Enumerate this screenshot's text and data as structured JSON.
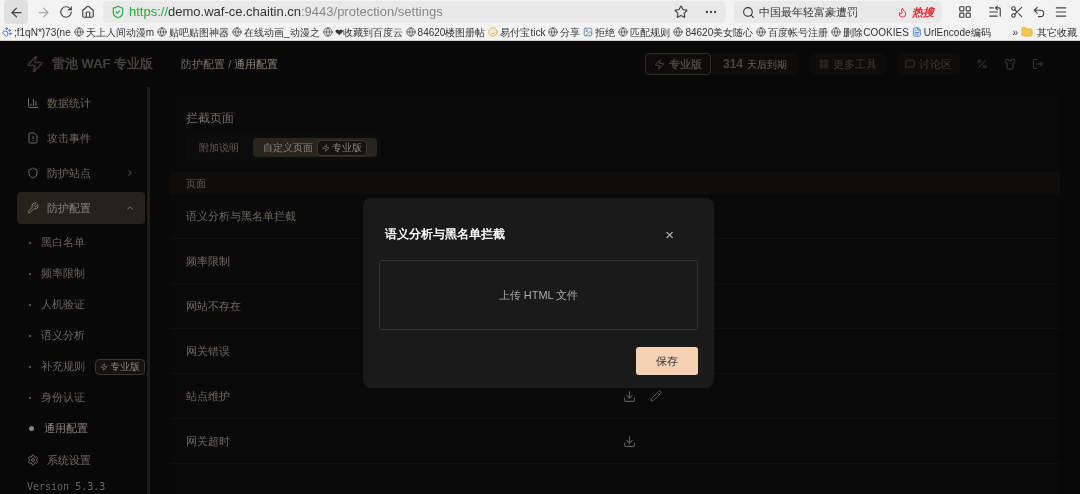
{
  "browser": {
    "url_host": "https://demo.waf-ce.chaitin.cn",
    "url_path": ":9443/protection/settings",
    "search_text": "中国最年轻富豪遭罚",
    "hot_label": "热搜",
    "bookmarks": [
      {
        "label": ";f1qN*)73(ne",
        "kind": "paw"
      },
      {
        "label": "天上人间动漫m",
        "kind": "globe"
      },
      {
        "label": "贴吧贴图神器",
        "kind": "globe"
      },
      {
        "label": "在线动画_动漫之",
        "kind": "globe"
      },
      {
        "label": "❤收藏到百度云",
        "kind": "globe"
      },
      {
        "label": "84620楼图册帖",
        "kind": "globe"
      },
      {
        "label": "易付宝tick",
        "kind": "coin"
      },
      {
        "label": "分享",
        "kind": "globe"
      },
      {
        "label": "拒绝",
        "kind": "image"
      },
      {
        "label": "匹配规则",
        "kind": "globe"
      },
      {
        "label": "84620美女随心",
        "kind": "globe"
      },
      {
        "label": "百度帐号注册",
        "kind": "globe"
      },
      {
        "label": "删除COOKIES",
        "kind": "globe"
      },
      {
        "label": "UrlEncode编码",
        "kind": "doc"
      }
    ],
    "overflow": "»",
    "other_folder": "其它收藏"
  },
  "app": {
    "brand": "雷池 WAF 专业版",
    "breadcrumb": [
      "防护配置",
      "通用配置"
    ],
    "breadcrumb_separator": "/",
    "header": {
      "pro_label": "专业版",
      "days": "314",
      "days_suffix": "天后到期",
      "tools": [
        {
          "label": "更多工具",
          "kind": "grid"
        },
        {
          "label": "讨论区",
          "kind": "chat"
        }
      ]
    },
    "sidebar": [
      {
        "label": "数据统计",
        "kind": "chart",
        "selected": false
      },
      {
        "label": "攻击事件",
        "kind": "doc",
        "selected": false
      },
      {
        "label": "防护站点",
        "kind": "shield",
        "expanded": false,
        "selected": false
      },
      {
        "label": "防护配置",
        "kind": "tools",
        "expanded": true,
        "selected": true,
        "children": [
          {
            "label": "黑白名单",
            "selected": false
          },
          {
            "label": "频率限制",
            "selected": false
          },
          {
            "label": "人机验证",
            "selected": false
          },
          {
            "label": "语义分析",
            "selected": false
          },
          {
            "label": "补充规则",
            "selected": false,
            "badge": "专业版"
          },
          {
            "label": "身份认证",
            "selected": false
          },
          {
            "label": "通用配置",
            "selected": true
          }
        ]
      },
      {
        "label": "系统设置",
        "kind": "gear",
        "selected": false
      }
    ],
    "version": "Version 5.3.3",
    "content": {
      "title": "拦截页面",
      "tabs": [
        {
          "label": "附加说明",
          "selected": false
        },
        {
          "label": "自定义页面",
          "selected": true,
          "badge": "专业版"
        }
      ],
      "section": "页面",
      "rows": [
        {
          "label": "语义分析与黑名单拦截"
        },
        {
          "label": "频率限制"
        },
        {
          "label": "网站不存在"
        },
        {
          "label": "网关错误"
        },
        {
          "label": "站点维护",
          "actions": [
            {
              "kind": "download"
            },
            {
              "kind": "edit"
            }
          ]
        },
        {
          "label": "网关超时",
          "actions": [
            {
              "kind": "download"
            }
          ]
        }
      ]
    }
  },
  "modal": {
    "title": "语义分析与黑名单拦截",
    "close": "×",
    "upload": "上传 HTML 文件",
    "save": "保存"
  }
}
